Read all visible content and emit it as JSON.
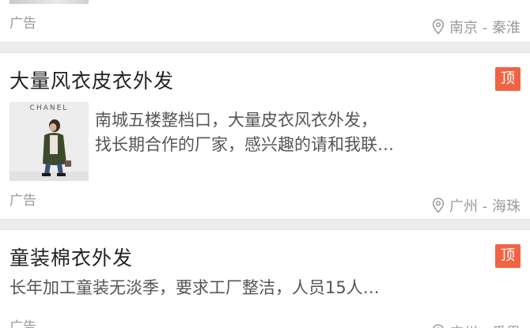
{
  "listings": [
    {
      "title": "",
      "description": "",
      "ad_label": "广告",
      "location": "南京 - 秦淮",
      "pinned": false
    },
    {
      "title": "大量风衣皮衣外发",
      "pinned_label": "顶",
      "thumb_text": "CHANEL",
      "description_lines": [
        "南城五楼整档口，大量皮衣风衣外发，",
        "找长期合作的厂家，感兴趣的请和我联…"
      ],
      "ad_label": "广告",
      "location": "广州 - 海珠",
      "pinned": true
    },
    {
      "title": "童装棉衣外发",
      "pinned_label": "顶",
      "description_lines": [
        "长年加工童装无淡季，要求工厂整洁，人员15人…"
      ],
      "ad_label": "广告",
      "location": "广州 - 番禺",
      "pinned": true
    }
  ],
  "colors": {
    "accent": "#f06444",
    "muted": "#9a9a9a",
    "background": "#ececec"
  },
  "icons": {
    "location": "map-pin-icon"
  }
}
